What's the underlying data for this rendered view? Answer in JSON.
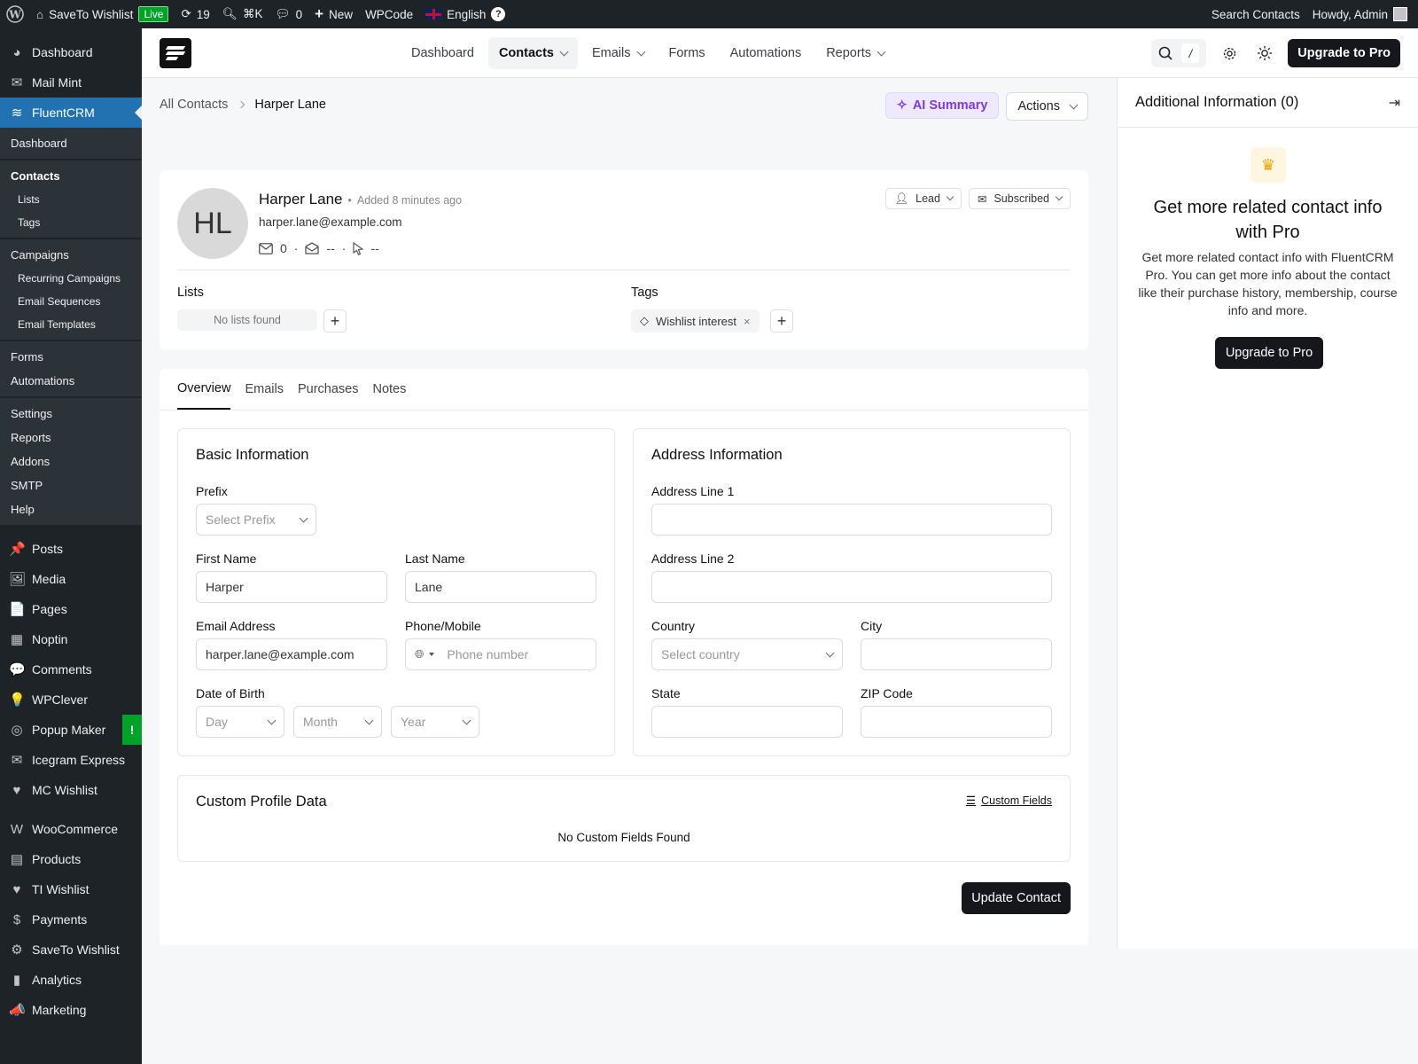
{
  "adminbar": {
    "site_name": "SaveTo Wishlist",
    "live": "Live",
    "updates": "19",
    "shortcut": "⌘K",
    "comments": "0",
    "new": "New",
    "wpcode": "WPCode",
    "language": "English",
    "search_contacts": "Search Contacts",
    "howdy": "Howdy, Admin"
  },
  "sidebar": {
    "top": [
      {
        "label": "Dashboard",
        "icon": "dashboard-icon"
      },
      {
        "label": "Mail Mint",
        "icon": "mail-icon"
      }
    ],
    "active": "FluentCRM",
    "sub": {
      "dashboard": "Dashboard",
      "contacts": "Contacts",
      "lists": "Lists",
      "tags": "Tags",
      "campaigns": "Campaigns",
      "recurring": "Recurring Campaigns",
      "sequences": "Email Sequences",
      "templates": "Email Templates",
      "forms": "Forms",
      "automations": "Automations",
      "settings": "Settings",
      "reports": "Reports",
      "addons": "Addons",
      "smtp": "SMTP",
      "help": "Help"
    },
    "items": [
      {
        "label": "Posts",
        "glyph": "📌"
      },
      {
        "label": "Media",
        "glyph": "🖼"
      },
      {
        "label": "Pages",
        "glyph": "📄"
      },
      {
        "label": "Noptin",
        "glyph": "▦"
      },
      {
        "label": "Comments",
        "glyph": "💬"
      },
      {
        "label": "WPClever",
        "glyph": "💡"
      },
      {
        "label": "Popup Maker",
        "glyph": "◎"
      },
      {
        "label": "Icegram Express",
        "glyph": "✉"
      },
      {
        "label": "MC Wishlist",
        "glyph": "♥"
      }
    ],
    "popup_badge": "!",
    "items2": [
      {
        "label": "WooCommerce",
        "glyph": "W"
      },
      {
        "label": "Products",
        "glyph": "▤"
      },
      {
        "label": "TI Wishlist",
        "glyph": "♥"
      },
      {
        "label": "Payments",
        "glyph": "$"
      },
      {
        "label": "SaveTo Wishlist",
        "glyph": "⚙"
      },
      {
        "label": "Analytics",
        "glyph": "▮"
      },
      {
        "label": "Marketing",
        "glyph": "📣"
      }
    ]
  },
  "topnav": {
    "links": [
      {
        "label": "Dashboard",
        "chevron": false
      },
      {
        "label": "Contacts",
        "chevron": true
      },
      {
        "label": "Emails",
        "chevron": true
      },
      {
        "label": "Forms",
        "chevron": false
      },
      {
        "label": "Automations",
        "chevron": false
      },
      {
        "label": "Reports",
        "chevron": true
      }
    ],
    "slash": "/",
    "upgrade": "Upgrade to Pro"
  },
  "breadcrumb": {
    "root": "All Contacts",
    "current": "Harper Lane"
  },
  "header_actions": {
    "ai_summary": "AI Summary",
    "actions": "Actions"
  },
  "contact": {
    "initials": "HL",
    "name": "Harper Lane",
    "added": "Added 8 minutes ago",
    "email": "harper.lane@example.com",
    "emails_sent": "0",
    "opens": "--",
    "clicks": "--",
    "type": "Lead",
    "status": "Subscribed",
    "lists_label": "Lists",
    "lists_empty": "No lists found",
    "tags_label": "Tags",
    "tags": [
      "Wishlist interest"
    ]
  },
  "tabs": [
    "Overview",
    "Emails",
    "Purchases",
    "Notes"
  ],
  "basic": {
    "title": "Basic Information",
    "prefix_label": "Prefix",
    "prefix_placeholder": "Select Prefix",
    "first_name_label": "First Name",
    "first_name": "Harper",
    "last_name_label": "Last Name",
    "last_name": "Lane",
    "email_label": "Email Address",
    "email": "harper.lane@example.com",
    "phone_label": "Phone/Mobile",
    "phone_placeholder": "Phone number",
    "dob_label": "Date of Birth",
    "day": "Day",
    "month": "Month",
    "year": "Year"
  },
  "address": {
    "title": "Address Information",
    "line1_label": "Address Line 1",
    "line2_label": "Address Line 2",
    "country_label": "Country",
    "country_placeholder": "Select country",
    "city_label": "City",
    "state_label": "State",
    "zip_label": "ZIP Code"
  },
  "custom": {
    "title": "Custom Profile Data",
    "link": "Custom Fields",
    "empty": "No Custom Fields Found"
  },
  "update_button": "Update Contact",
  "right_panel": {
    "title": "Additional Information (0)",
    "promo_title": "Get more related contact info with Pro",
    "promo_desc": "Get more related contact info with FluentCRM Pro. You can get more info about the contact like their purchase history, membership, course info and more.",
    "promo_button": "Upgrade to Pro"
  }
}
